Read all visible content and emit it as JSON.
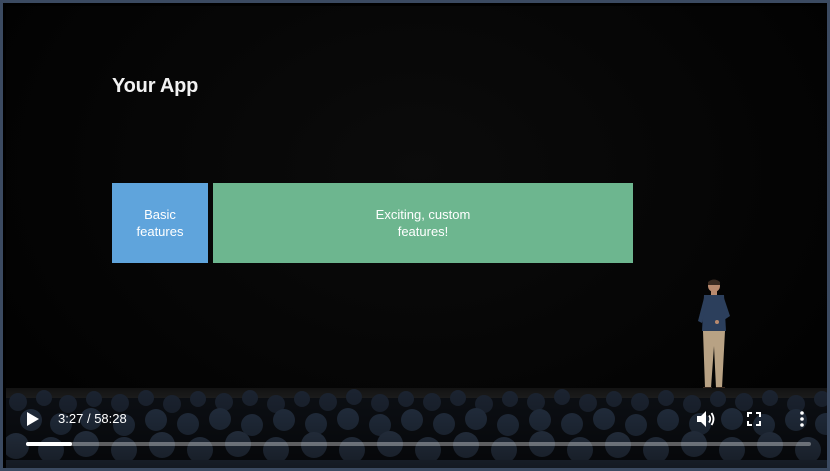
{
  "slide": {
    "title": "Your App",
    "basic_box": "Basic\nfeatures",
    "custom_box": "Exciting, custom\nfeatures!"
  },
  "player": {
    "current_time": "3:27",
    "separator": "/",
    "duration": "58:28",
    "progress_fraction": 0.0591,
    "icons": {
      "play": "play-icon",
      "volume": "volume-icon",
      "fullscreen": "fullscreen-icon",
      "more": "more-vert-icon"
    }
  },
  "colors": {
    "basic_box": "#5fa4dc",
    "custom_box": "#6db68f",
    "frame_border": "#3b4a61"
  }
}
